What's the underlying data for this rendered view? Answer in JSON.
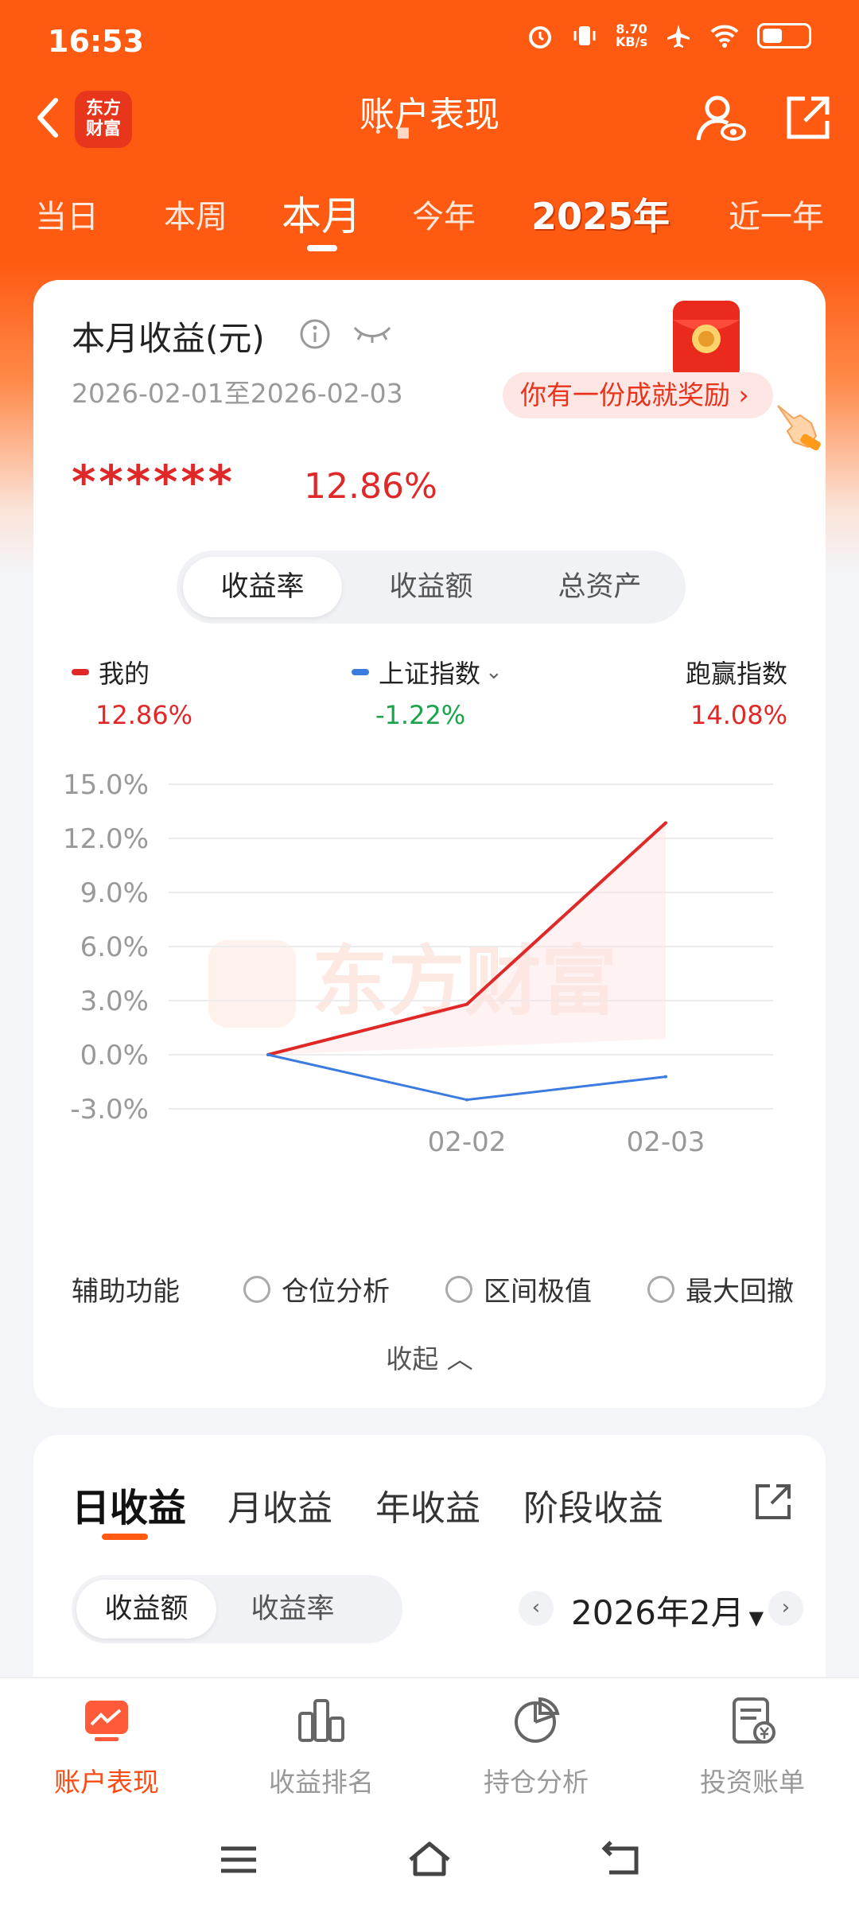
{
  "status_bar": {
    "time": "16:53",
    "net_speed": "8.70",
    "net_unit": "KB/s"
  },
  "nav": {
    "title": "账户表现",
    "logo_text_1": "东方",
    "logo_text_2": "财富"
  },
  "period_tabs": [
    {
      "label": "当日"
    },
    {
      "label": "本周"
    },
    {
      "label": "本月"
    },
    {
      "label": "今年"
    },
    {
      "label": "2025年"
    },
    {
      "label": "近一年"
    }
  ],
  "active_period": "本月",
  "summary": {
    "title": "本月收益(元)",
    "date_range": "2026-02-01至2026-02-03",
    "masked_amount": "******",
    "return_pct": "12.86%",
    "reward_text": "你有一份成就奖励",
    "reward_arrow": "›"
  },
  "metric_tabs": [
    {
      "label": "收益率"
    },
    {
      "label": "收益额"
    },
    {
      "label": "总资产"
    }
  ],
  "legend": {
    "mine": {
      "name": "我的",
      "value": "12.86%",
      "color": "#e02828"
    },
    "index": {
      "name": "上证指数",
      "value": "-1.22%",
      "color": "#3b7be0",
      "value_color": "#19a34a"
    },
    "beat": {
      "name": "跑赢指数",
      "value": "14.08%",
      "color": "#e02828"
    }
  },
  "watermark": "东方财富",
  "chart_data": {
    "type": "line",
    "x": [
      "02-01",
      "02-02",
      "02-03"
    ],
    "x_tick_labels": [
      "02-02",
      "02-03"
    ],
    "series": [
      {
        "name": "我的",
        "values": [
          0.0,
          2.8,
          12.86
        ],
        "color": "#e02828"
      },
      {
        "name": "上证指数",
        "values": [
          0.0,
          -2.5,
          -1.22
        ],
        "color": "#3b7be0"
      }
    ],
    "y_ticks": [
      "15.0%",
      "12.0%",
      "9.0%",
      "6.0%",
      "3.0%",
      "0.0%",
      "-3.0%"
    ],
    "ylim": [
      -3,
      15
    ],
    "grid": true
  },
  "aux": {
    "label": "辅助功能",
    "options": [
      {
        "label": "仓位分析"
      },
      {
        "label": "区间极值"
      },
      {
        "label": "最大回撤"
      }
    ]
  },
  "collapse_label": "收起",
  "revenue_tabs": [
    {
      "label": "日收益"
    },
    {
      "label": "月收益"
    },
    {
      "label": "年收益"
    },
    {
      "label": "阶段收益"
    }
  ],
  "revenue_seg": [
    {
      "label": "收益额"
    },
    {
      "label": "收益率"
    }
  ],
  "month_nav": {
    "label": "2026年2月",
    "prev": "‹",
    "next": "›"
  },
  "bottom_nav": [
    {
      "label": "账户表现"
    },
    {
      "label": "收益排名"
    },
    {
      "label": "持仓分析"
    },
    {
      "label": "投资账单"
    }
  ]
}
